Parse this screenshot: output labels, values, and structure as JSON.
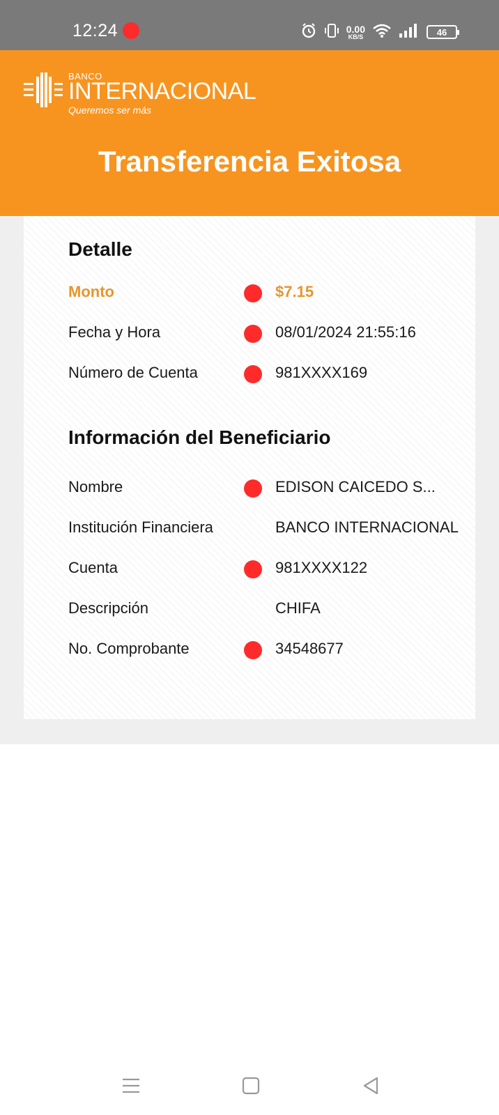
{
  "status_bar": {
    "time": "12:24",
    "net_speed_value": "0.00",
    "net_speed_unit": "KB/S",
    "battery": "46"
  },
  "brand": {
    "bank_small": "BANCO",
    "bank_big": "INTERNACIONAL",
    "tagline": "Queremos ser más",
    "accent_color": "#f7941f"
  },
  "page": {
    "title": "Transferencia Exitosa"
  },
  "detalle": {
    "heading": "Detalle",
    "rows": [
      {
        "label": "Monto",
        "value": "$7.15"
      },
      {
        "label": "Fecha y Hora",
        "value": "08/01/2024 21:55:16"
      },
      {
        "label": "Número de Cuenta",
        "value": "981XXXX169"
      }
    ]
  },
  "beneficiario": {
    "heading": "Información del Beneficiario",
    "rows": [
      {
        "label": "Nombre",
        "value": "EDISON CAICEDO S..."
      },
      {
        "label": "Institución Financiera",
        "value": "BANCO INTERNACIONAL"
      },
      {
        "label": "Cuenta",
        "value": "981XXXX122"
      },
      {
        "label": "Descripción",
        "value": "CHIFA"
      },
      {
        "label": "No. Comprobante",
        "value": "34548677"
      }
    ]
  },
  "colors": {
    "status_bar": "#7a7a7a",
    "redaction_dot": "#ff2a2a",
    "amount": "#e8952c"
  }
}
